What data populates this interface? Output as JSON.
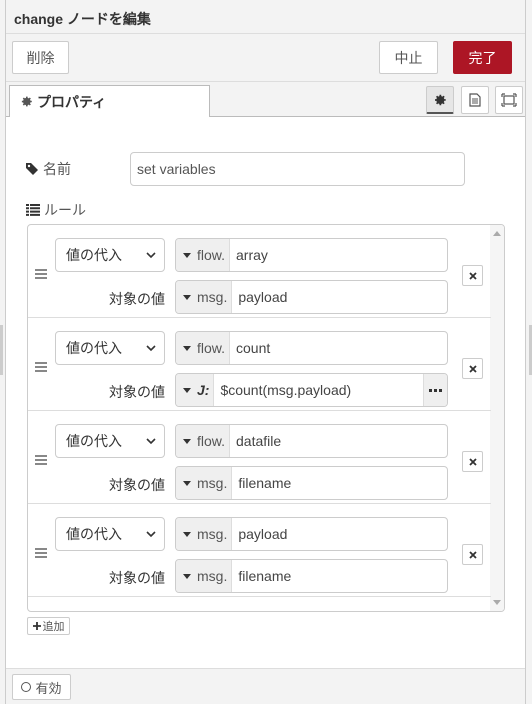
{
  "header": {
    "title": "change ノードを編集"
  },
  "toolbar": {
    "delete_label": "削除",
    "cancel_label": "中止",
    "done_label": "完了"
  },
  "tabs": {
    "properties_label": "プロパティ"
  },
  "form": {
    "name_label": "名前",
    "name_value": "set variables",
    "rules_label": "ルール",
    "add_label": "追加"
  },
  "rules": [
    {
      "action": "値の代入",
      "target_prefix": "flow.",
      "target_value": "array",
      "value_label": "対象の値",
      "value_prefix": "msg.",
      "value_value": "payload"
    },
    {
      "action": "値の代入",
      "target_prefix": "flow.",
      "target_value": "count",
      "value_label": "対象の値",
      "value_prefix": "J:",
      "value_value": "$count(msg.payload)"
    },
    {
      "action": "値の代入",
      "target_prefix": "flow.",
      "target_value": "datafile",
      "value_label": "対象の値",
      "value_prefix": "msg.",
      "value_value": "filename"
    },
    {
      "action": "値の代入",
      "target_prefix": "msg.",
      "target_value": "payload",
      "value_label": "対象の値",
      "value_prefix": "msg.",
      "value_value": "filename"
    }
  ],
  "footer": {
    "enable_label": "有効"
  },
  "colors": {
    "done_button": "#ad1625",
    "header_bg": "#f3f3f3",
    "border": "#cccccc"
  },
  "icons": [
    "gear-icon",
    "tag-icon",
    "list-icon",
    "description-icon",
    "appearance-icon",
    "grip-icon",
    "chevron-down-icon",
    "caret-down-icon",
    "close-icon",
    "plus-icon",
    "circle-icon",
    "ellipsis-icon"
  ]
}
